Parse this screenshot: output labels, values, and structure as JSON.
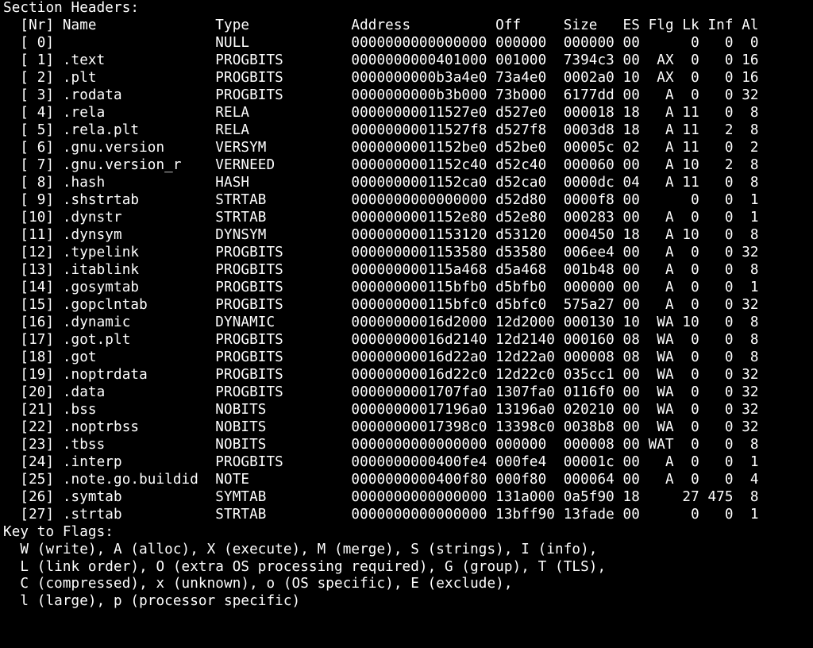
{
  "title": "Section Headers:",
  "columns": [
    "[Nr]",
    "Name",
    "Type",
    "Address",
    "Off",
    "Size",
    "ES",
    "Flg",
    "Lk",
    "Inf",
    "Al"
  ],
  "rows": [
    {
      "nr": 0,
      "name": "",
      "type": "NULL",
      "addr": "0000000000000000",
      "off": "000000",
      "size": "000000",
      "es": "00",
      "flg": "",
      "lk": 0,
      "inf": 0,
      "al": 0
    },
    {
      "nr": 1,
      "name": ".text",
      "type": "PROGBITS",
      "addr": "0000000000401000",
      "off": "001000",
      "size": "7394c3",
      "es": "00",
      "flg": "AX",
      "lk": 0,
      "inf": 0,
      "al": 16
    },
    {
      "nr": 2,
      "name": ".plt",
      "type": "PROGBITS",
      "addr": "0000000000b3a4e0",
      "off": "73a4e0",
      "size": "0002a0",
      "es": "10",
      "flg": "AX",
      "lk": 0,
      "inf": 0,
      "al": 16
    },
    {
      "nr": 3,
      "name": ".rodata",
      "type": "PROGBITS",
      "addr": "0000000000b3b000",
      "off": "73b000",
      "size": "6177dd",
      "es": "00",
      "flg": "A",
      "lk": 0,
      "inf": 0,
      "al": 32
    },
    {
      "nr": 4,
      "name": ".rela",
      "type": "RELA",
      "addr": "00000000011527e0",
      "off": "d527e0",
      "size": "000018",
      "es": "18",
      "flg": "A",
      "lk": 11,
      "inf": 0,
      "al": 8
    },
    {
      "nr": 5,
      "name": ".rela.plt",
      "type": "RELA",
      "addr": "00000000011527f8",
      "off": "d527f8",
      "size": "0003d8",
      "es": "18",
      "flg": "A",
      "lk": 11,
      "inf": 2,
      "al": 8
    },
    {
      "nr": 6,
      "name": ".gnu.version",
      "type": "VERSYM",
      "addr": "0000000001152be0",
      "off": "d52be0",
      "size": "00005c",
      "es": "02",
      "flg": "A",
      "lk": 11,
      "inf": 0,
      "al": 2
    },
    {
      "nr": 7,
      "name": ".gnu.version_r",
      "type": "VERNEED",
      "addr": "0000000001152c40",
      "off": "d52c40",
      "size": "000060",
      "es": "00",
      "flg": "A",
      "lk": 10,
      "inf": 2,
      "al": 8
    },
    {
      "nr": 8,
      "name": ".hash",
      "type": "HASH",
      "addr": "0000000001152ca0",
      "off": "d52ca0",
      "size": "0000dc",
      "es": "04",
      "flg": "A",
      "lk": 11,
      "inf": 0,
      "al": 8
    },
    {
      "nr": 9,
      "name": ".shstrtab",
      "type": "STRTAB",
      "addr": "0000000000000000",
      "off": "d52d80",
      "size": "0000f8",
      "es": "00",
      "flg": "",
      "lk": 0,
      "inf": 0,
      "al": 1
    },
    {
      "nr": 10,
      "name": ".dynstr",
      "type": "STRTAB",
      "addr": "0000000001152e80",
      "off": "d52e80",
      "size": "000283",
      "es": "00",
      "flg": "A",
      "lk": 0,
      "inf": 0,
      "al": 1
    },
    {
      "nr": 11,
      "name": ".dynsym",
      "type": "DYNSYM",
      "addr": "0000000001153120",
      "off": "d53120",
      "size": "000450",
      "es": "18",
      "flg": "A",
      "lk": 10,
      "inf": 0,
      "al": 8
    },
    {
      "nr": 12,
      "name": ".typelink",
      "type": "PROGBITS",
      "addr": "0000000001153580",
      "off": "d53580",
      "size": "006ee4",
      "es": "00",
      "flg": "A",
      "lk": 0,
      "inf": 0,
      "al": 32
    },
    {
      "nr": 13,
      "name": ".itablink",
      "type": "PROGBITS",
      "addr": "000000000115a468",
      "off": "d5a468",
      "size": "001b48",
      "es": "00",
      "flg": "A",
      "lk": 0,
      "inf": 0,
      "al": 8
    },
    {
      "nr": 14,
      "name": ".gosymtab",
      "type": "PROGBITS",
      "addr": "000000000115bfb0",
      "off": "d5bfb0",
      "size": "000000",
      "es": "00",
      "flg": "A",
      "lk": 0,
      "inf": 0,
      "al": 1
    },
    {
      "nr": 15,
      "name": ".gopclntab",
      "type": "PROGBITS",
      "addr": "000000000115bfc0",
      "off": "d5bfc0",
      "size": "575a27",
      "es": "00",
      "flg": "A",
      "lk": 0,
      "inf": 0,
      "al": 32
    },
    {
      "nr": 16,
      "name": ".dynamic",
      "type": "DYNAMIC",
      "addr": "00000000016d2000",
      "off": "12d2000",
      "size": "000130",
      "es": "10",
      "flg": "WA",
      "lk": 10,
      "inf": 0,
      "al": 8
    },
    {
      "nr": 17,
      "name": ".got.plt",
      "type": "PROGBITS",
      "addr": "00000000016d2140",
      "off": "12d2140",
      "size": "000160",
      "es": "08",
      "flg": "WA",
      "lk": 0,
      "inf": 0,
      "al": 8
    },
    {
      "nr": 18,
      "name": ".got",
      "type": "PROGBITS",
      "addr": "00000000016d22a0",
      "off": "12d22a0",
      "size": "000008",
      "es": "08",
      "flg": "WA",
      "lk": 0,
      "inf": 0,
      "al": 8
    },
    {
      "nr": 19,
      "name": ".noptrdata",
      "type": "PROGBITS",
      "addr": "00000000016d22c0",
      "off": "12d22c0",
      "size": "035cc1",
      "es": "00",
      "flg": "WA",
      "lk": 0,
      "inf": 0,
      "al": 32
    },
    {
      "nr": 20,
      "name": ".data",
      "type": "PROGBITS",
      "addr": "0000000001707fa0",
      "off": "1307fa0",
      "size": "0116f0",
      "es": "00",
      "flg": "WA",
      "lk": 0,
      "inf": 0,
      "al": 32
    },
    {
      "nr": 21,
      "name": ".bss",
      "type": "NOBITS",
      "addr": "00000000017196a0",
      "off": "13196a0",
      "size": "020210",
      "es": "00",
      "flg": "WA",
      "lk": 0,
      "inf": 0,
      "al": 32
    },
    {
      "nr": 22,
      "name": ".noptrbss",
      "type": "NOBITS",
      "addr": "00000000017398c0",
      "off": "13398c0",
      "size": "0038b8",
      "es": "00",
      "flg": "WA",
      "lk": 0,
      "inf": 0,
      "al": 32
    },
    {
      "nr": 23,
      "name": ".tbss",
      "type": "NOBITS",
      "addr": "0000000000000000",
      "off": "000000",
      "size": "000008",
      "es": "00",
      "flg": "WAT",
      "lk": 0,
      "inf": 0,
      "al": 8
    },
    {
      "nr": 24,
      "name": ".interp",
      "type": "PROGBITS",
      "addr": "0000000000400fe4",
      "off": "000fe4",
      "size": "00001c",
      "es": "00",
      "flg": "A",
      "lk": 0,
      "inf": 0,
      "al": 1
    },
    {
      "nr": 25,
      "name": ".note.go.buildid",
      "type": "NOTE",
      "addr": "0000000000400f80",
      "off": "000f80",
      "size": "000064",
      "es": "00",
      "flg": "A",
      "lk": 0,
      "inf": 0,
      "al": 4
    },
    {
      "nr": 26,
      "name": ".symtab",
      "type": "SYMTAB",
      "addr": "0000000000000000",
      "off": "131a000",
      "size": "0a5f90",
      "es": "18",
      "flg": "",
      "lk": 27,
      "inf": 475,
      "al": 8
    },
    {
      "nr": 27,
      "name": ".strtab",
      "type": "STRTAB",
      "addr": "0000000000000000",
      "off": "13bff90",
      "size": "13fade",
      "es": "00",
      "flg": "",
      "lk": 0,
      "inf": 0,
      "al": 1
    }
  ],
  "flags_key": {
    "title": "Key to Flags:",
    "lines": [
      "W (write), A (alloc), X (execute), M (merge), S (strings), I (info),",
      "L (link order), O (extra OS processing required), G (group), T (TLS),",
      "C (compressed), x (unknown), o (OS specific), E (exclude),",
      "l (large), p (processor specific)"
    ]
  }
}
